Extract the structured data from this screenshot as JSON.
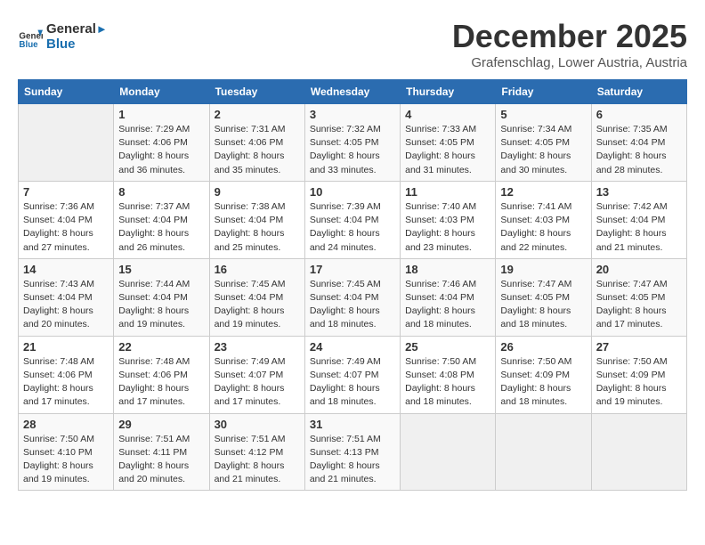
{
  "header": {
    "logo_line1": "General",
    "logo_line2": "Blue",
    "month": "December 2025",
    "location": "Grafenschlag, Lower Austria, Austria"
  },
  "weekdays": [
    "Sunday",
    "Monday",
    "Tuesday",
    "Wednesday",
    "Thursday",
    "Friday",
    "Saturday"
  ],
  "weeks": [
    [
      {
        "day": "",
        "info": ""
      },
      {
        "day": "1",
        "info": "Sunrise: 7:29 AM\nSunset: 4:06 PM\nDaylight: 8 hours\nand 36 minutes."
      },
      {
        "day": "2",
        "info": "Sunrise: 7:31 AM\nSunset: 4:06 PM\nDaylight: 8 hours\nand 35 minutes."
      },
      {
        "day": "3",
        "info": "Sunrise: 7:32 AM\nSunset: 4:05 PM\nDaylight: 8 hours\nand 33 minutes."
      },
      {
        "day": "4",
        "info": "Sunrise: 7:33 AM\nSunset: 4:05 PM\nDaylight: 8 hours\nand 31 minutes."
      },
      {
        "day": "5",
        "info": "Sunrise: 7:34 AM\nSunset: 4:05 PM\nDaylight: 8 hours\nand 30 minutes."
      },
      {
        "day": "6",
        "info": "Sunrise: 7:35 AM\nSunset: 4:04 PM\nDaylight: 8 hours\nand 28 minutes."
      }
    ],
    [
      {
        "day": "7",
        "info": "Sunrise: 7:36 AM\nSunset: 4:04 PM\nDaylight: 8 hours\nand 27 minutes."
      },
      {
        "day": "8",
        "info": "Sunrise: 7:37 AM\nSunset: 4:04 PM\nDaylight: 8 hours\nand 26 minutes."
      },
      {
        "day": "9",
        "info": "Sunrise: 7:38 AM\nSunset: 4:04 PM\nDaylight: 8 hours\nand 25 minutes."
      },
      {
        "day": "10",
        "info": "Sunrise: 7:39 AM\nSunset: 4:04 PM\nDaylight: 8 hours\nand 24 minutes."
      },
      {
        "day": "11",
        "info": "Sunrise: 7:40 AM\nSunset: 4:03 PM\nDaylight: 8 hours\nand 23 minutes."
      },
      {
        "day": "12",
        "info": "Sunrise: 7:41 AM\nSunset: 4:03 PM\nDaylight: 8 hours\nand 22 minutes."
      },
      {
        "day": "13",
        "info": "Sunrise: 7:42 AM\nSunset: 4:04 PM\nDaylight: 8 hours\nand 21 minutes."
      }
    ],
    [
      {
        "day": "14",
        "info": "Sunrise: 7:43 AM\nSunset: 4:04 PM\nDaylight: 8 hours\nand 20 minutes."
      },
      {
        "day": "15",
        "info": "Sunrise: 7:44 AM\nSunset: 4:04 PM\nDaylight: 8 hours\nand 19 minutes."
      },
      {
        "day": "16",
        "info": "Sunrise: 7:45 AM\nSunset: 4:04 PM\nDaylight: 8 hours\nand 19 minutes."
      },
      {
        "day": "17",
        "info": "Sunrise: 7:45 AM\nSunset: 4:04 PM\nDaylight: 8 hours\nand 18 minutes."
      },
      {
        "day": "18",
        "info": "Sunrise: 7:46 AM\nSunset: 4:04 PM\nDaylight: 8 hours\nand 18 minutes."
      },
      {
        "day": "19",
        "info": "Sunrise: 7:47 AM\nSunset: 4:05 PM\nDaylight: 8 hours\nand 18 minutes."
      },
      {
        "day": "20",
        "info": "Sunrise: 7:47 AM\nSunset: 4:05 PM\nDaylight: 8 hours\nand 17 minutes."
      }
    ],
    [
      {
        "day": "21",
        "info": "Sunrise: 7:48 AM\nSunset: 4:06 PM\nDaylight: 8 hours\nand 17 minutes."
      },
      {
        "day": "22",
        "info": "Sunrise: 7:48 AM\nSunset: 4:06 PM\nDaylight: 8 hours\nand 17 minutes."
      },
      {
        "day": "23",
        "info": "Sunrise: 7:49 AM\nSunset: 4:07 PM\nDaylight: 8 hours\nand 17 minutes."
      },
      {
        "day": "24",
        "info": "Sunrise: 7:49 AM\nSunset: 4:07 PM\nDaylight: 8 hours\nand 18 minutes."
      },
      {
        "day": "25",
        "info": "Sunrise: 7:50 AM\nSunset: 4:08 PM\nDaylight: 8 hours\nand 18 minutes."
      },
      {
        "day": "26",
        "info": "Sunrise: 7:50 AM\nSunset: 4:09 PM\nDaylight: 8 hours\nand 18 minutes."
      },
      {
        "day": "27",
        "info": "Sunrise: 7:50 AM\nSunset: 4:09 PM\nDaylight: 8 hours\nand 19 minutes."
      }
    ],
    [
      {
        "day": "28",
        "info": "Sunrise: 7:50 AM\nSunset: 4:10 PM\nDaylight: 8 hours\nand 19 minutes."
      },
      {
        "day": "29",
        "info": "Sunrise: 7:51 AM\nSunset: 4:11 PM\nDaylight: 8 hours\nand 20 minutes."
      },
      {
        "day": "30",
        "info": "Sunrise: 7:51 AM\nSunset: 4:12 PM\nDaylight: 8 hours\nand 21 minutes."
      },
      {
        "day": "31",
        "info": "Sunrise: 7:51 AM\nSunset: 4:13 PM\nDaylight: 8 hours\nand 21 minutes."
      },
      {
        "day": "",
        "info": ""
      },
      {
        "day": "",
        "info": ""
      },
      {
        "day": "",
        "info": ""
      }
    ]
  ]
}
